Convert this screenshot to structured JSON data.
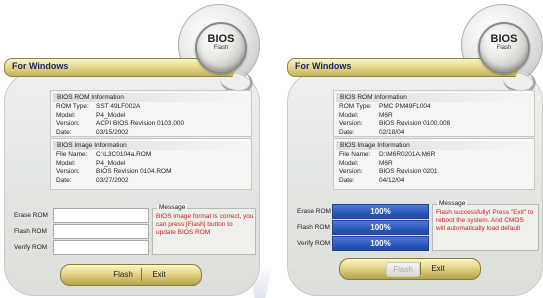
{
  "left": {
    "badge": {
      "main": "BIOS",
      "sub": "Flash"
    },
    "title": "For Windows",
    "rom_info": {
      "header": "BIOS ROM Information",
      "rows": [
        {
          "k": "ROM Type:",
          "v": "SST 49LF002A"
        },
        {
          "k": "Model:",
          "v": "P4_Model"
        },
        {
          "k": "Version:",
          "v": "ACPI BIOS Revision 0103.000"
        },
        {
          "k": "Date:",
          "v": "03/15/2002"
        }
      ]
    },
    "image_info": {
      "header": "BIOS Image Information",
      "rows": [
        {
          "k": "File Name:",
          "v": "C:\\L3C0104a.ROM"
        },
        {
          "k": "Model:",
          "v": "P4_Model"
        },
        {
          "k": "Version:",
          "v": "BIOS Revision 0104.ROM"
        },
        {
          "k": "Date:",
          "v": "03/27/2002"
        }
      ]
    },
    "actions": {
      "erase": "Erase ROM",
      "flash": "Flash ROM",
      "verify": "Verify ROM"
    },
    "message": {
      "title": "Message",
      "text": "BIOS image format is correct, you can press [Flash] button to update BIOS ROM"
    },
    "buttons": {
      "flash": "Flash",
      "exit": "Exit"
    }
  },
  "right": {
    "badge": {
      "main": "BIOS",
      "sub": "Flash"
    },
    "title": "For Windows",
    "rom_info": {
      "header": "BIOS ROM Information",
      "rows": [
        {
          "k": "ROM Type:",
          "v": "PMC PM49FL004"
        },
        {
          "k": "Model:",
          "v": "M6R"
        },
        {
          "k": "Version:",
          "v": "BIOS Revision 0100.008"
        },
        {
          "k": "Date:",
          "v": "02/18/04"
        }
      ]
    },
    "image_info": {
      "header": "BIOS Image Information",
      "rows": [
        {
          "k": "File Name:",
          "v": "D:\\M6R0201A.M6R"
        },
        {
          "k": "Model:",
          "v": "M6R"
        },
        {
          "k": "Version:",
          "v": "BIOS Revision 0201"
        },
        {
          "k": "Date:",
          "v": "04/12/04"
        }
      ]
    },
    "actions": {
      "erase": "Erase ROM",
      "flash": "Flash ROM",
      "verify": "Verify ROM"
    },
    "progress": {
      "erase": "100%",
      "flash": "100%",
      "verify": "100%"
    },
    "message": {
      "title": "Message",
      "text": "Flash successfully! Press \"Exit\" to reboot the system. And CMOS will automatically load default"
    },
    "buttons": {
      "flash": "Flash",
      "exit": "Exit"
    }
  },
  "colors": {
    "progress_fill": "#2c57bf",
    "message_text": "#cc2222",
    "title_text": "#24246a"
  }
}
